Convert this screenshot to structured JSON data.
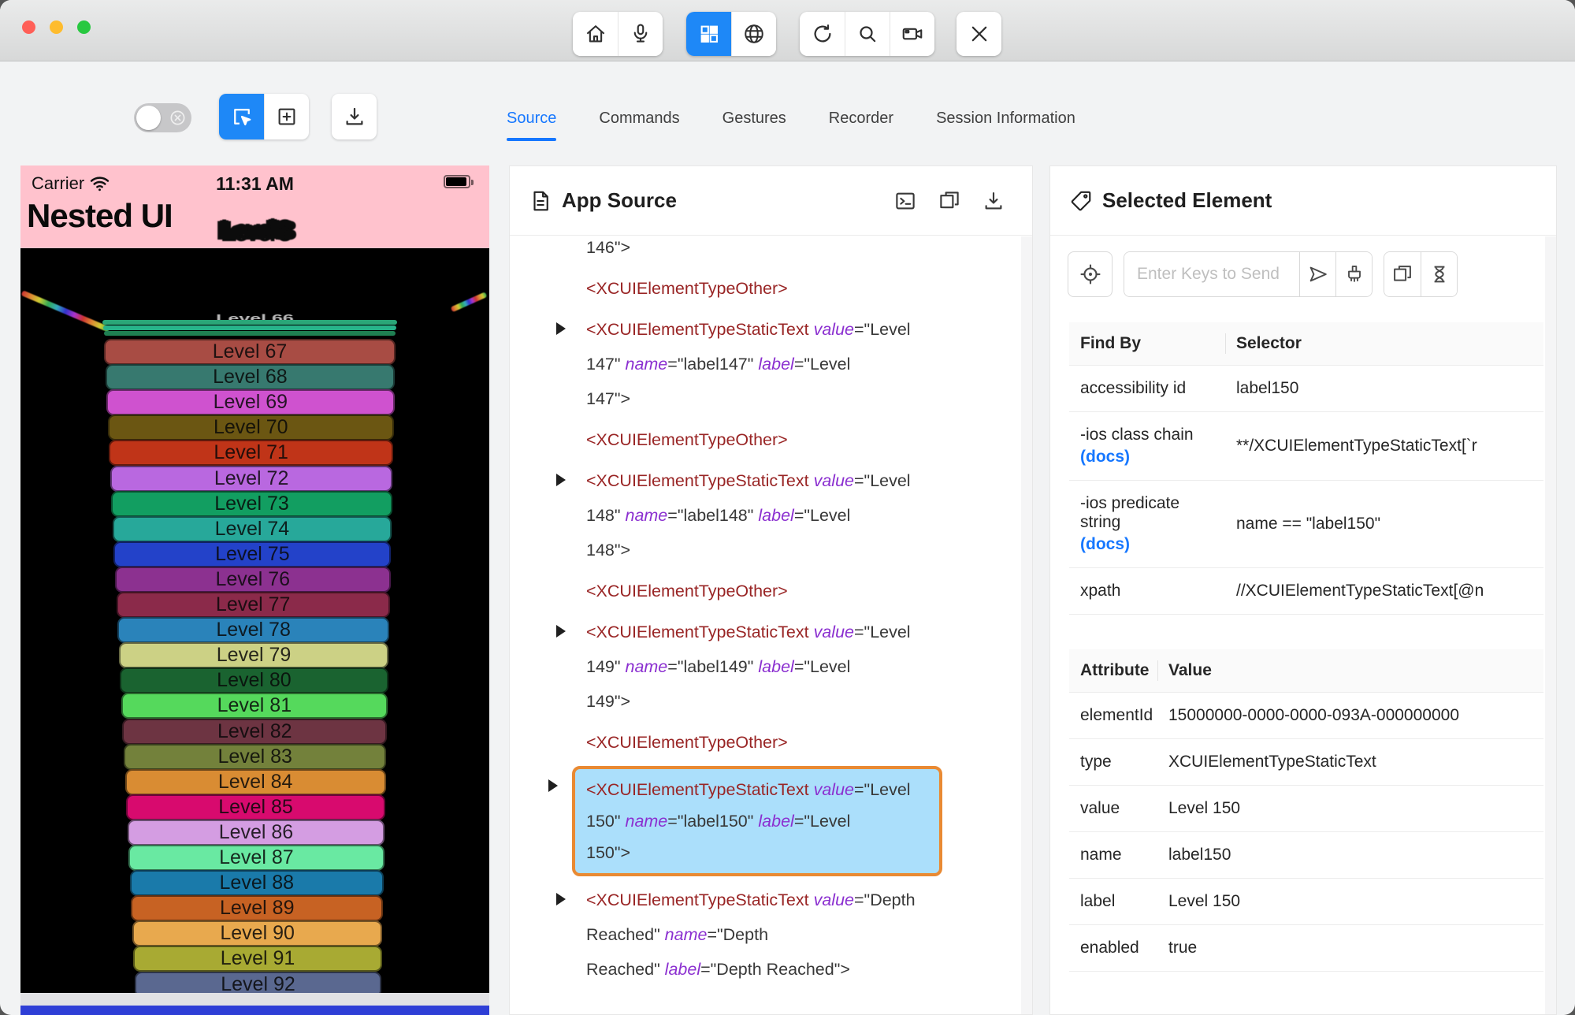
{
  "colors": {
    "accent": "#1e88f7",
    "link": "#1677ff",
    "phone_pink": "#ffc2cd",
    "code_tag": "#992525",
    "code_attr": "#8b2fd0",
    "code_plain": "#383838",
    "highlight_bg": "#abdffb",
    "highlight_border": "#e98a33",
    "traffic_lights": [
      "#ff5f57",
      "#febc2e",
      "#28c840"
    ]
  },
  "titlebar": {
    "icons": [
      "home-icon",
      "microphone-icon",
      "grid-icon",
      "globe-icon",
      "refresh-icon",
      "search-icon",
      "screen-recording-icon",
      "close-icon"
    ],
    "active_icon": "grid-icon"
  },
  "toolbar": {
    "toggle_state": "off",
    "tool_icons": [
      "select-element-icon",
      "add-element-icon",
      "download-icon"
    ],
    "tabs": [
      {
        "label": "Source",
        "active": true
      },
      {
        "label": "Commands",
        "active": false
      },
      {
        "label": "Gestures",
        "active": false
      },
      {
        "label": "Recorder",
        "active": false
      },
      {
        "label": "Session Information",
        "active": false
      }
    ]
  },
  "phone": {
    "carrier": "Carrier",
    "time": "11:31 AM",
    "app_title": "Nested UI",
    "overlap_text": "Level 8",
    "squished_label": "Level 66",
    "sliver_colors": [
      "#2aa678",
      "#27b38a",
      "#1f7f52"
    ],
    "levels": [
      {
        "label": "Level 67",
        "color": "#a84c44"
      },
      {
        "label": "Level 68",
        "color": "#37796f"
      },
      {
        "label": "Level 69",
        "color": "#cf52cf"
      },
      {
        "label": "Level 70",
        "color": "#6b5612"
      },
      {
        "label": "Level 71",
        "color": "#c03418"
      },
      {
        "label": "Level 72",
        "color": "#b968e0"
      },
      {
        "label": "Level 73",
        "color": "#129e61"
      },
      {
        "label": "Level 74",
        "color": "#27a89a"
      },
      {
        "label": "Level 75",
        "color": "#2342c9"
      },
      {
        "label": "Level 76",
        "color": "#8c3190"
      },
      {
        "label": "Level 77",
        "color": "#8b2a4a"
      },
      {
        "label": "Level 78",
        "color": "#2a83ba"
      },
      {
        "label": "Level 79",
        "color": "#ccd185"
      },
      {
        "label": "Level 80",
        "color": "#1a6330"
      },
      {
        "label": "Level 81",
        "color": "#55d95c"
      },
      {
        "label": "Level 82",
        "color": "#6d3442"
      },
      {
        "label": "Level 83",
        "color": "#73813b"
      },
      {
        "label": "Level 84",
        "color": "#d98c33"
      },
      {
        "label": "Level 85",
        "color": "#d80a6e"
      },
      {
        "label": "Level 86",
        "color": "#d49de2"
      },
      {
        "label": "Level 87",
        "color": "#69e9a2"
      },
      {
        "label": "Level 88",
        "color": "#1a7aaa"
      },
      {
        "label": "Level 89",
        "color": "#c76223"
      },
      {
        "label": "Level 90",
        "color": "#e8a94e"
      },
      {
        "label": "Level 91",
        "color": "#a8aa33"
      },
      {
        "label": "Level 92",
        "color": "#5a6890"
      }
    ],
    "bottom_strips": [
      {
        "color": "#e2e2e5"
      },
      {
        "color": "#2e3ed6"
      }
    ]
  },
  "source_panel": {
    "title": "App Source",
    "action_icons": [
      "terminal-icon",
      "copy-icon",
      "download-icon"
    ],
    "code": [
      {
        "exp": false,
        "selected": false,
        "lines": [
          [
            {
              "k": "plain",
              "t": "146\">"
            }
          ]
        ]
      },
      {
        "exp": false,
        "selected": false,
        "lines": [
          [
            {
              "k": "tag",
              "t": "<XCUIElementTypeOther>"
            }
          ]
        ]
      },
      {
        "exp": true,
        "selected": false,
        "lines": [
          [
            {
              "k": "tag",
              "t": "<XCUIElementTypeStaticText "
            },
            {
              "k": "attr",
              "t": "value"
            },
            {
              "k": "plain",
              "t": "=\"Level"
            }
          ],
          [
            {
              "k": "plain",
              "t": "147\" "
            },
            {
              "k": "attr",
              "t": "name"
            },
            {
              "k": "plain",
              "t": "=\"label147\" "
            },
            {
              "k": "attr",
              "t": "label"
            },
            {
              "k": "plain",
              "t": "=\"Level"
            }
          ],
          [
            {
              "k": "plain",
              "t": "147\">"
            }
          ]
        ]
      },
      {
        "exp": false,
        "selected": false,
        "lines": [
          [
            {
              "k": "tag",
              "t": "<XCUIElementTypeOther>"
            }
          ]
        ]
      },
      {
        "exp": true,
        "selected": false,
        "lines": [
          [
            {
              "k": "tag",
              "t": "<XCUIElementTypeStaticText "
            },
            {
              "k": "attr",
              "t": "value"
            },
            {
              "k": "plain",
              "t": "=\"Level"
            }
          ],
          [
            {
              "k": "plain",
              "t": "148\" "
            },
            {
              "k": "attr",
              "t": "name"
            },
            {
              "k": "plain",
              "t": "=\"label148\" "
            },
            {
              "k": "attr",
              "t": "label"
            },
            {
              "k": "plain",
              "t": "=\"Level"
            }
          ],
          [
            {
              "k": "plain",
              "t": "148\">"
            }
          ]
        ]
      },
      {
        "exp": false,
        "selected": false,
        "lines": [
          [
            {
              "k": "tag",
              "t": "<XCUIElementTypeOther>"
            }
          ]
        ]
      },
      {
        "exp": true,
        "selected": false,
        "lines": [
          [
            {
              "k": "tag",
              "t": "<XCUIElementTypeStaticText "
            },
            {
              "k": "attr",
              "t": "value"
            },
            {
              "k": "plain",
              "t": "=\"Level"
            }
          ],
          [
            {
              "k": "plain",
              "t": "149\" "
            },
            {
              "k": "attr",
              "t": "name"
            },
            {
              "k": "plain",
              "t": "=\"label149\" "
            },
            {
              "k": "attr",
              "t": "label"
            },
            {
              "k": "plain",
              "t": "=\"Level"
            }
          ],
          [
            {
              "k": "plain",
              "t": "149\">"
            }
          ]
        ]
      },
      {
        "exp": false,
        "selected": false,
        "lines": [
          [
            {
              "k": "tag",
              "t": "<XCUIElementTypeOther>"
            }
          ]
        ]
      },
      {
        "exp": true,
        "selected": true,
        "lines": [
          [
            {
              "k": "tag",
              "t": "<XCUIElementTypeStaticText "
            },
            {
              "k": "attr",
              "t": "value"
            },
            {
              "k": "plain",
              "t": "=\"Level"
            }
          ],
          [
            {
              "k": "plain",
              "t": "150\" "
            },
            {
              "k": "attr",
              "t": "name"
            },
            {
              "k": "plain",
              "t": "=\"label150\" "
            },
            {
              "k": "attr",
              "t": "label"
            },
            {
              "k": "plain",
              "t": "=\"Level"
            }
          ],
          [
            {
              "k": "plain",
              "t": "150\">"
            }
          ]
        ]
      },
      {
        "exp": true,
        "selected": false,
        "lines": [
          [
            {
              "k": "tag",
              "t": "<XCUIElementTypeStaticText "
            },
            {
              "k": "attr",
              "t": "value"
            },
            {
              "k": "plain",
              "t": "=\"Depth"
            }
          ],
          [
            {
              "k": "plain",
              "t": "Reached\" "
            },
            {
              "k": "attr",
              "t": "name"
            },
            {
              "k": "plain",
              "t": "=\"Depth"
            }
          ],
          [
            {
              "k": "plain",
              "t": "Reached\" "
            },
            {
              "k": "attr",
              "t": "label"
            },
            {
              "k": "plain",
              "t": "=\"Depth Reached\">"
            }
          ]
        ]
      }
    ]
  },
  "selected_panel": {
    "title": "Selected Element",
    "keys_input": {
      "placeholder": "Enter Keys to Send"
    },
    "action_icons": [
      "locate-icon",
      "send-icon",
      "clear-icon",
      "copy-icon",
      "hourglass-icon"
    ],
    "find_by_table": {
      "headers": [
        "Find By",
        "Selector"
      ],
      "rows": [
        {
          "find_by": "accessibility id",
          "docs": "",
          "selector": "label150"
        },
        {
          "find_by": "-ios class chain",
          "docs": "(docs)",
          "selector": "**/XCUIElementTypeStaticText[`r"
        },
        {
          "find_by": "-ios predicate string",
          "docs": "(docs)",
          "selector": "name == \"label150\""
        },
        {
          "find_by": "xpath",
          "docs": "",
          "selector": "//XCUIElementTypeStaticText[@n"
        }
      ]
    },
    "attribute_table": {
      "headers": [
        "Attribute",
        "Value"
      ],
      "rows": [
        {
          "attribute": "elementId",
          "value": "15000000-0000-0000-093A-000000000"
        },
        {
          "attribute": "type",
          "value": "XCUIElementTypeStaticText"
        },
        {
          "attribute": "value",
          "value": "Level 150"
        },
        {
          "attribute": "name",
          "value": "label150"
        },
        {
          "attribute": "label",
          "value": "Level 150"
        },
        {
          "attribute": "enabled",
          "value": "true"
        }
      ]
    }
  }
}
